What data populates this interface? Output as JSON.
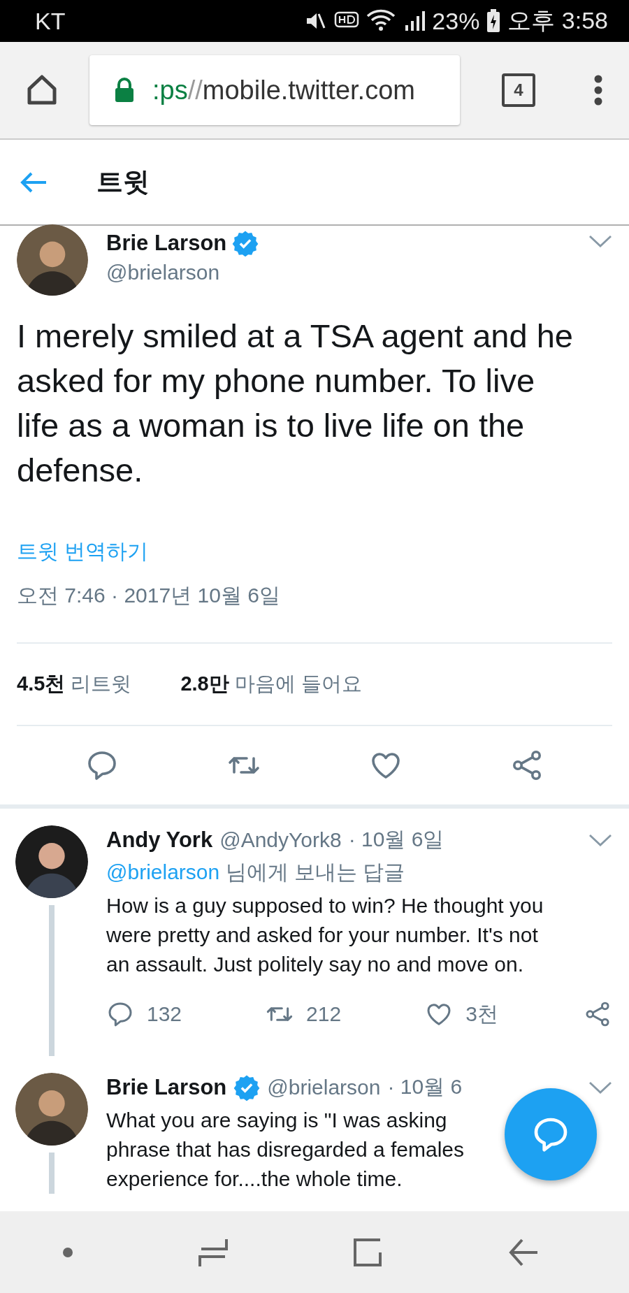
{
  "status_bar": {
    "carrier": "KT",
    "battery": "23%",
    "time": "오후 3:58"
  },
  "browser": {
    "url_scheme": ":ps",
    "url_sep": "//",
    "url_host": "mobile.twitter.com",
    "tab_count": "4"
  },
  "header": {
    "title": "트윗"
  },
  "tweet": {
    "name": "Brie Larson",
    "verified": true,
    "handle": "@brielarson",
    "text": "I merely smiled at a TSA agent and he asked for my phone number. To live life as a woman is to live life on the defense.",
    "translate": "트윗 번역하기",
    "timestamp": "오전 7:46 · 2017년 10월 6일",
    "stats": [
      {
        "count": "4.5천",
        "label": "리트윗"
      },
      {
        "count": "2.8만",
        "label": "마음에 들어요"
      }
    ]
  },
  "replies": [
    {
      "name": "Andy York",
      "verified": false,
      "handle": "@AndyYork8",
      "date": "· 10월 6일",
      "reply_to": "@brielarson",
      "reply_suffix": "님에게 보내는 답글",
      "text_lines": [
        "How is a guy supposed to win? He thought you",
        "were pretty and asked for your number. It's not",
        "an assault. Just politely say no and move on."
      ],
      "counts": {
        "replies": "132",
        "retweets": "212",
        "likes": "3천"
      }
    },
    {
      "name": "Brie Larson",
      "verified": true,
      "handle": "@brielarson",
      "date": "· 10월 6",
      "text_lines": [
        "What you are saying is \"I was asking",
        "phrase that has disregarded a females",
        "experience for....the whole time."
      ]
    }
  ]
}
